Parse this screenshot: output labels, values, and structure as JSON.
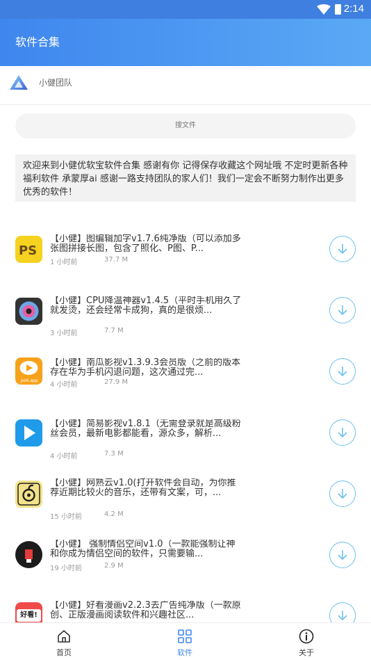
{
  "status_bar": {
    "time": "2:14",
    "icons": [
      "wifi-icon",
      "battery-icon"
    ]
  },
  "app_bar": {
    "title": "软件合集"
  },
  "team": {
    "name": "小健团队",
    "logo_icon": "triangle-logo-icon"
  },
  "search": {
    "placeholder": "搜文件"
  },
  "notice": {
    "text": "欢迎来到小健优软宝软件合集 感谢有你 记得保存收藏这个网址哦 不定时更新各种福利软件 承蒙厚ai 感谢一路支持团队的家人们！我们一定会不断努力制作出更多优秀的软件！"
  },
  "colors": {
    "accent": "#3f86ee",
    "download_ring": "#6cc0f0"
  },
  "files": [
    {
      "name": "【小健】图编辑加字v1.7.6纯净版（可以添加多张图拼接长图，包含了照化、P图、P...",
      "age": "1 小时前",
      "size": "37.7 M",
      "icon": "ps-editor-icon"
    },
    {
      "name": "【小健】CPU降温神器v1.4.5（平时手机用久了就发烫，还会经常卡成狗，真的是很烦...",
      "age": "3 小时前",
      "size": "7.7 M",
      "icon": "cooling-fan-icon"
    },
    {
      "name": "【小健】南瓜影视v1.3.9.3会员版（之前的版本存在华为手机闪退问题，这次通过完...",
      "age": "4 小时前",
      "size": "27.9 M",
      "icon": "pumpkin-video-icon"
    },
    {
      "name": "【小健】简易影视v1.8.1（无需登录就是高级粉丝会员，最新电影都能看，源众多，解析...",
      "age": "4 小时前",
      "size": "7.3 M",
      "icon": "play-icon"
    },
    {
      "name": "【小健】网熟云v1.0(打开软件会自动，为你推荐近期比较火的音乐，还带有文案，可，...",
      "age": "15 小时前",
      "size": "4.2 M",
      "icon": "music-disc-icon"
    },
    {
      "name": "【小健】 强制情侣空间v1.0（一款能强制让神和你成为情侣空间的软件，只需要输...",
      "age": "19 小时前",
      "size": "2.9 M",
      "icon": "couple-space-icon"
    },
    {
      "name": "【小健】好看漫画v2.2.3去广告纯净版（一款原创、正版漫画阅读软件和兴趣社区...",
      "age": "",
      "size": "",
      "icon": "comic-icon",
      "badge": "好看!"
    }
  ],
  "tabs": [
    {
      "label": "首页",
      "icon": "home-icon",
      "active": false
    },
    {
      "label": "软件",
      "icon": "grid-icon",
      "active": true
    },
    {
      "label": "关于",
      "icon": "info-icon",
      "active": false
    }
  ]
}
